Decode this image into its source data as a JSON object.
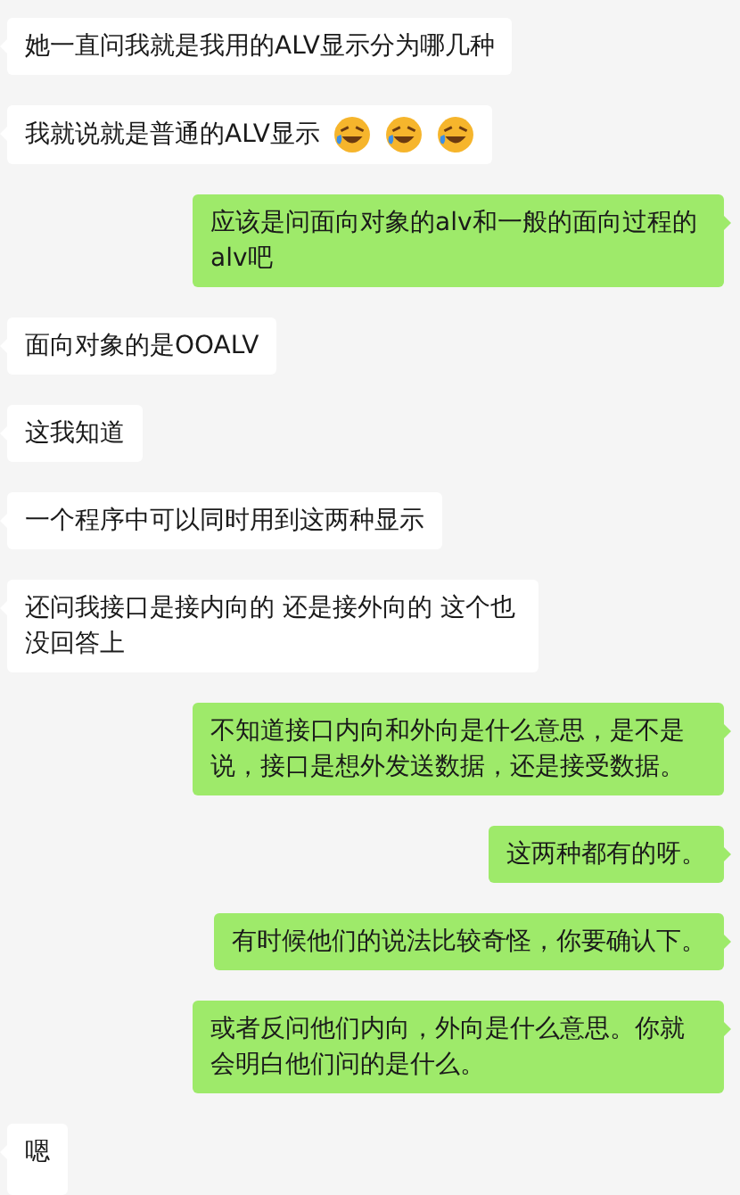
{
  "messages": [
    {
      "outgoing": false,
      "parts": [
        {
          "kind": "text",
          "text": "她一直问我就是我用的ALV显示分为哪几种"
        }
      ]
    },
    {
      "outgoing": false,
      "parts": [
        {
          "kind": "text",
          "text": "我就说就是普通的ALV显示"
        },
        {
          "kind": "emoji"
        },
        {
          "kind": "emoji"
        },
        {
          "kind": "emoji"
        }
      ]
    },
    {
      "outgoing": true,
      "parts": [
        {
          "kind": "text",
          "text": "应该是问面向对象的alv和一般的面向过程的alv吧"
        }
      ]
    },
    {
      "outgoing": false,
      "parts": [
        {
          "kind": "text",
          "text": "面向对象的是OOALV"
        }
      ]
    },
    {
      "outgoing": false,
      "parts": [
        {
          "kind": "text",
          "text": "这我知道"
        }
      ]
    },
    {
      "outgoing": false,
      "parts": [
        {
          "kind": "text",
          "text": "一个程序中可以同时用到这两种显示"
        }
      ]
    },
    {
      "outgoing": false,
      "parts": [
        {
          "kind": "text",
          "text": "还问我接口是接内向的 还是接外向的 这个也没回答上"
        }
      ]
    },
    {
      "outgoing": true,
      "parts": [
        {
          "kind": "text",
          "text": "不知道接口内向和外向是什么意思，是不是说，接口是想外发送数据，还是接受数据。"
        }
      ]
    },
    {
      "outgoing": true,
      "parts": [
        {
          "kind": "text",
          "text": "这两种都有的呀。"
        }
      ]
    },
    {
      "outgoing": true,
      "parts": [
        {
          "kind": "text",
          "text": "有时候他们的说法比较奇怪，你要确认下。"
        }
      ]
    },
    {
      "outgoing": true,
      "parts": [
        {
          "kind": "text",
          "text": "或者反问他们内向，外向是什么意思。你就会明白他们问的是什么。"
        }
      ]
    },
    {
      "outgoing": false,
      "parts": [
        {
          "kind": "text",
          "text": "嗯"
        }
      ]
    }
  ]
}
